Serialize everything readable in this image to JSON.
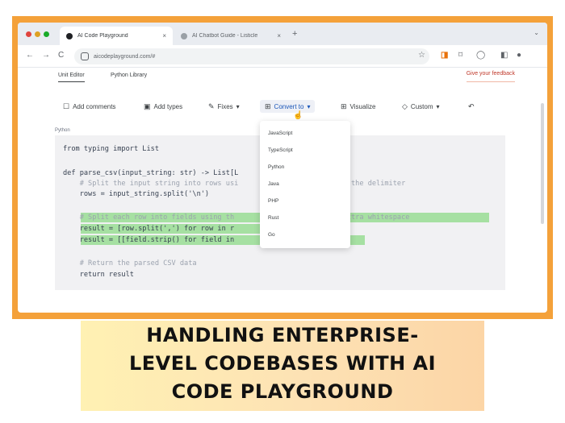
{
  "browser": {
    "tabs": [
      {
        "title": "AI Code Playground"
      },
      {
        "title": "AI Chatbot Guide - Listicle"
      }
    ],
    "new_tab_glyph": "+",
    "tab_close_glyph": "×",
    "dropdown_glyph": "⌄",
    "nav": {
      "back": "←",
      "forward": "→",
      "reload": "C"
    },
    "url": "aicodeplayground.com/#",
    "extension_icons": [
      "star-icon",
      "extension-icon",
      "bookmark-icon",
      "download-icon",
      "sidebar-icon",
      "profile-icon"
    ]
  },
  "app": {
    "tabs": [
      {
        "label": "Unit Editor"
      },
      {
        "label": "Python Library"
      }
    ],
    "feedback_label": "Give your feedback",
    "actions": [
      {
        "icon": "comment-icon",
        "glyph": "☐",
        "label": "Add comments"
      },
      {
        "icon": "types-icon",
        "glyph": "▣",
        "label": "Add types"
      },
      {
        "icon": "fix-icon",
        "glyph": "✎",
        "label": "Fixes",
        "chevron": "▾"
      },
      {
        "icon": "convert-icon",
        "glyph": "⊞",
        "label": "Convert to",
        "chevron": "▾"
      },
      {
        "icon": "visualize-icon",
        "glyph": "⊞",
        "label": "Visualize"
      },
      {
        "icon": "custom-icon",
        "glyph": "◇",
        "label": "Custom",
        "chevron": "▾"
      },
      {
        "icon": "undo-icon",
        "glyph": "↶",
        "label": ""
      }
    ],
    "language_label": "Python",
    "convert_menu": [
      "JavaScript",
      "TypeScript",
      "Python",
      "Java",
      "PHP",
      "Rust",
      "Go"
    ]
  },
  "code": {
    "lines": [
      "from typing import List",
      "",
      "def parse_csv(input_string: str) -> List[L",
      "    # Split the input string into rows usi                    ted as the delimiter",
      "    rows = input_string.split('\\n')",
      "",
      "    # Split each row into fields using th                      ove extra whitespace",
      "    result = [row.split(',') for row in r",
      "    result = [[field.strip() for field in                          t]",
      "",
      "    # Return the parsed CSV data",
      "    return result"
    ]
  },
  "banner": {
    "lines": [
      "HANDLING ENTERPRISE-",
      "LEVEL CODEBASES WITH AI",
      "CODE PLAYGROUND"
    ]
  },
  "colors": {
    "frame": "#f4a13a",
    "highlight": "#a6e0a2",
    "feedback": "#c0392b"
  }
}
